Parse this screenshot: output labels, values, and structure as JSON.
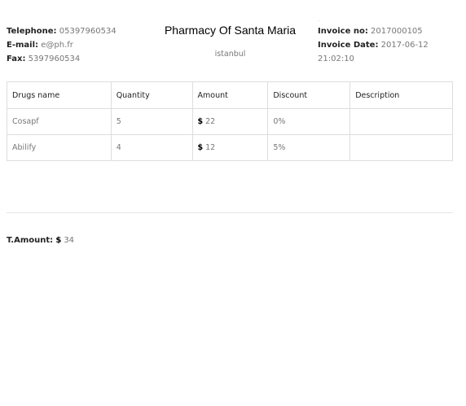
{
  "header": {
    "telephone_label": "Telephone:",
    "telephone_value": "05397960534",
    "email_label": "E-mail:",
    "email_value": "e@ph.fr",
    "fax_label": "Fax:",
    "fax_value": "5397960534",
    "pharmacy_name": "Pharmacy Of Santa Maria",
    "city": "istanbul",
    "mark": ".",
    "invoice_no_label": "Invoice no:",
    "invoice_no_value": "2017000105",
    "invoice_date_label": "Invoice Date:",
    "invoice_date_value": "2017-06-12 21:02:10"
  },
  "table": {
    "columns": [
      "Drugs name",
      "Quantity",
      "Amount",
      "Discount",
      "Description"
    ],
    "currency_symbol": "$",
    "rows": [
      {
        "drug": "Cosapf",
        "quantity": "5",
        "amount": "22",
        "discount": "0%",
        "description": ""
      },
      {
        "drug": "Abilify",
        "quantity": "4",
        "amount": "12",
        "discount": "5%",
        "description": ""
      }
    ]
  },
  "total": {
    "label": "T.Amount:",
    "currency_symbol": "$",
    "value": "34"
  }
}
